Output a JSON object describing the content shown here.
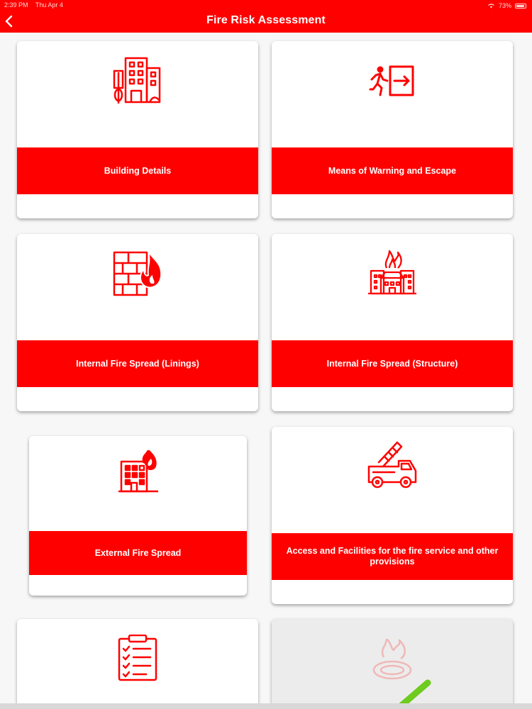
{
  "status_bar": {
    "time": "2:39 PM",
    "date": "Thu Apr 4",
    "battery": "73%",
    "battery_level": 0.73
  },
  "header": {
    "title": "Fire Risk Assessment",
    "back_icon": "chevron-left-icon"
  },
  "colors": {
    "brand": "#ff0000",
    "card": "#ffffff",
    "disabled_card": "#ececec",
    "check": "#6ecb1f"
  },
  "tiles": [
    {
      "label": "Building Details",
      "icon": "building-icon"
    },
    {
      "label": "Means of Warning and Escape",
      "icon": "emergency-exit-icon"
    },
    {
      "label": "Internal Fire Spread (Linings)",
      "icon": "brick-wall-fire-icon"
    },
    {
      "label": "Internal Fire Spread (Structure)",
      "icon": "buildings-on-fire-icon"
    },
    {
      "label": "External Fire Spread",
      "icon": "building-fire-icon"
    },
    {
      "label": "Access and Facilities for the fire service and other provisions",
      "icon": "fire-truck-icon"
    },
    {
      "icon": "checklist-icon"
    },
    {
      "icon": "fire-ring-icon",
      "status_icon": "checkmark-icon"
    }
  ]
}
